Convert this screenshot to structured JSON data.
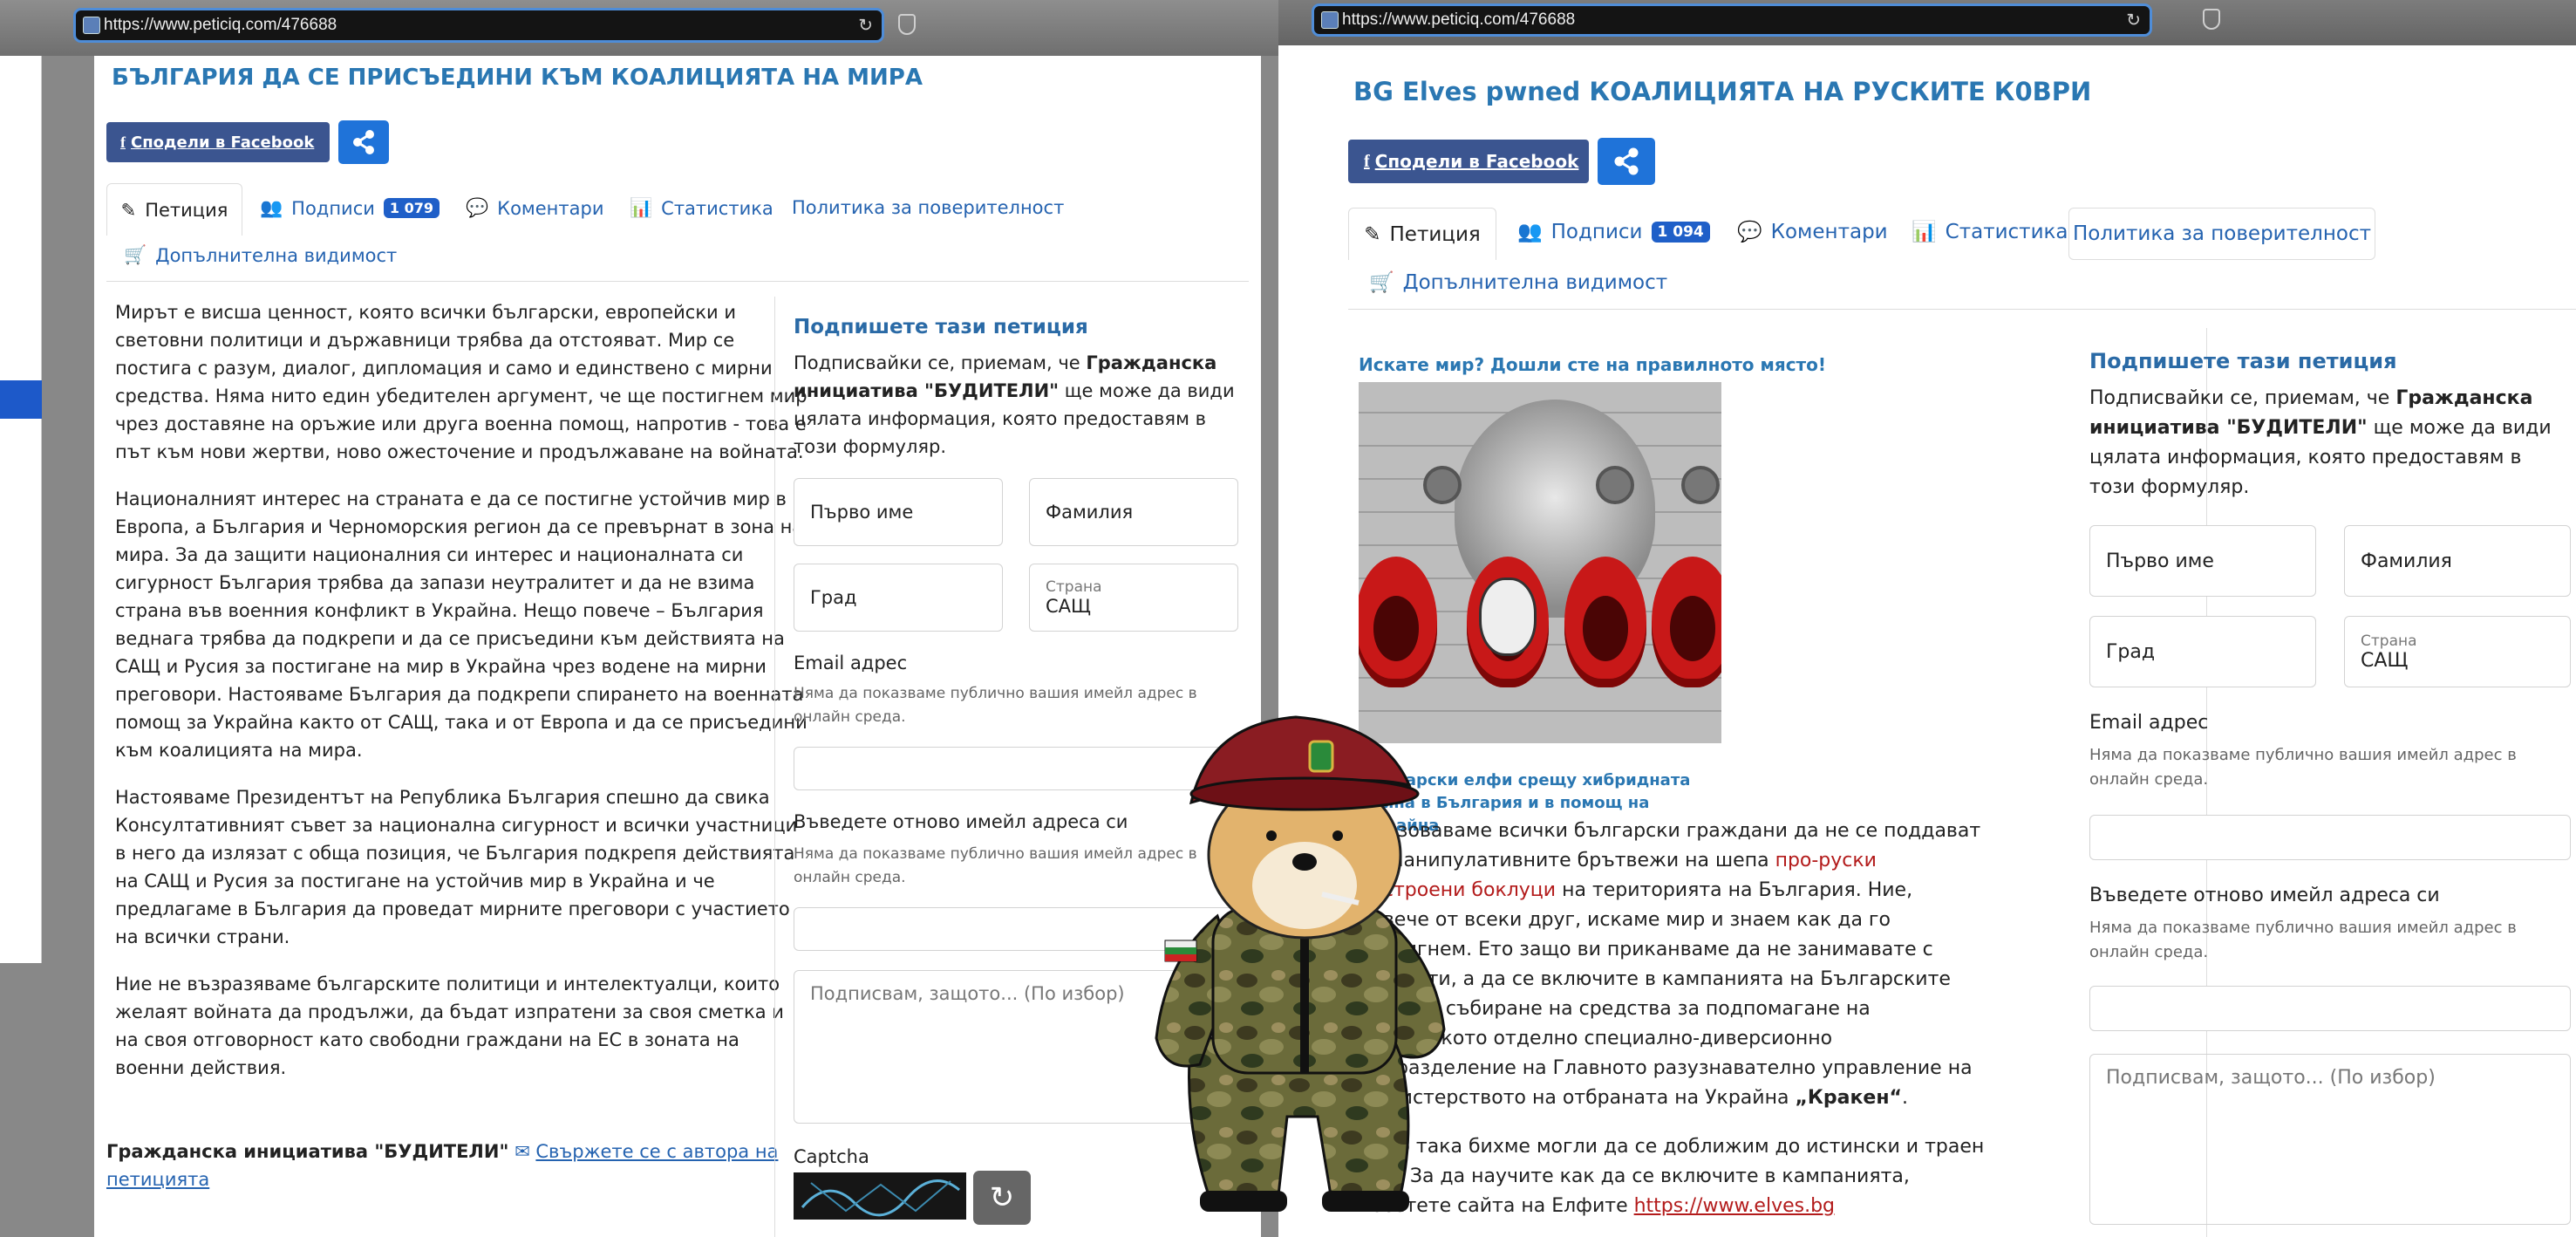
{
  "left": {
    "url": "https://www.peticiq.com/476688",
    "title": "БЪЛГАРИЯ ДА СЕ ПРИСЪЕДИНИ КЪМ КОАЛИЦИЯТА НА МИРА",
    "facebook_label": "Сподели в Facebook",
    "tabs": {
      "petition": "Петиция",
      "signatures": "Подписи",
      "signatures_count": "1 079",
      "comments": "Коментари",
      "stats": "Статистика",
      "privacy": "Политика за поверителност",
      "visibility": "Допълнителна видимост"
    },
    "paragraphs": [
      "Мирът е висша ценност, която всички български, европейски и световни политици и държавници трябва да отстояват. Мир се постига с разум, диалог, дипломация и само и единствено с мирни средства. Няма нито един убедителен аргумент, че ще постигнем мир чрез доставяне на оръжие или друга военна помощ, напротив - това е път към нови жертви, ново ожесточение и продължаване на войната.",
      "Националният интерес на страната е да се постигне устойчив мир в Европа, а България и Черноморския регион да се превърнат в зона на мира. За да защити националния си интерес и националната си сигурност България трябва да запази неутралитет и да не взима страна във военния конфликт в Украйна. Нещо повече – България веднага трябва да подкрепи и да се присъедини към действията на САЩ и Русия за постигане на мир в Украйна чрез водене на мирни преговори. Настояваме България да подкрепи спирането на военната помощ за Украйна както от САЩ, така и от Европа и да се присъедини към коалицията на мира.",
      "Настояваме Президентът на Република България спешно да свика Консултативният съвет за национална сигурност и всички участници в него да излязат с обща позиция, че България подкрепя действията на САЩ и Русия за постигане на устойчив мир в Украйна и че предлагаме в България да проведат мирните преговори с участието на всички страни.",
      "Ние не възразяваме българските политици и интелектуалци, които желаят войната да продължи, да бъдат изпратени за своя сметка и на своя отговорност като свободни граждани на ЕС в зоната на военни действия."
    ],
    "author_name": "Гражданска инициатива \"БУДИТЕЛИ\"",
    "contact_link": "Свържете се с автора на петицията",
    "side": {
      "title": "Подпишете тази петиция",
      "intro_start": "Подписвайки се, приемам, че ",
      "intro_bold": "Гражданска инициатива \"БУДИТЕЛИ\"",
      "intro_end": " ще може да види цялата информация, която предоставям в този формуляр.",
      "first_name": "Първо име",
      "last_name": "Фамилия",
      "city": "Град",
      "country_label": "Страна",
      "country_value": "САЩ",
      "email_label": "Email адрес",
      "email_hint": "Няма да показваме публично вашия имейл адрес в онлайн среда.",
      "reemail_label": "Въведете отново имейл адреса си",
      "reemail_hint": "Няма да показваме публично вашия имейл адрес в онлайн среда.",
      "reason_placeholder": "Подписвам, защото... (По избор)",
      "captcha_label": "Captcha"
    }
  },
  "right": {
    "url": "https://www.peticiq.com/476688",
    "title": "BG Elves pwned КОАЛИЦИЯТА НА РУСКИТЕ К0ВРИ",
    "facebook_label": "Сподели в Facebook",
    "tabs": {
      "petition": "Петиция",
      "signatures": "Подписи",
      "signatures_count": "1 094",
      "comments": "Коментари",
      "stats": "Статистика",
      "privacy": "Политика за поверителност",
      "visibility": "Допълнителна видимост"
    },
    "tagline": "Искате мир? Дошли сте на правилното място!",
    "caption": "Български елфи срещу хибридната война в България и в помощ на Украйна",
    "para1_start": "Призоваваме всички български граждани да не се поддават на манипулативните брътвежи на шепа ",
    "para1_link": "про-руски настроени боклуци",
    "para1_end": " на територията на България. Ние, повече от всеки друг, искаме мир и знаем как да го постигнем. Ето защо ви приканваме да не занимавате с глупости, а да се включите в кампанията на Българските елфи за събиране на средства за подпомагане на украинското отделно специално-диверсионно подразделение на Главното разузнавателно управление на Министерството на отбраната на Украйна ",
    "para1_bold": "„Кракен“",
    "para1_tail": ".",
    "para2": "Само така бихме могли да се доближим до истински и траен мир. За да научите как да се включите в кампанията, посетете сайта на Елфите ",
    "para2_link": "https://www.elves.bg",
    "side": {
      "title": "Подпишете тази петиция",
      "intro_start": "Подписвайки се, приемам, че ",
      "intro_bold": "Гражданска инициатива \"БУДИТЕЛИ\"",
      "intro_end": " ще може да види цялата информация, която предоставям в този формуляр.",
      "first_name": "Първо име",
      "last_name": "Фамилия",
      "city": "Град",
      "country_label": "Страна",
      "country_value": "САЩ",
      "email_label": "Email адрес",
      "email_hint": "Няма да показваме публично вашия имейл адрес в онлайн среда.",
      "reemail_label": "Въведете отново имейл адреса си",
      "reemail_hint": "Няма да показваме публично вашия имейл адрес в онлайн среда.",
      "reason_placeholder": "Подписвам, защото... (По избор)"
    }
  },
  "colors": {
    "accent": "#2a77b2",
    "facebook": "#3b5590",
    "share": "#1f73d9",
    "badge": "#1f5fc8",
    "url_border": "#4f8dd8"
  }
}
